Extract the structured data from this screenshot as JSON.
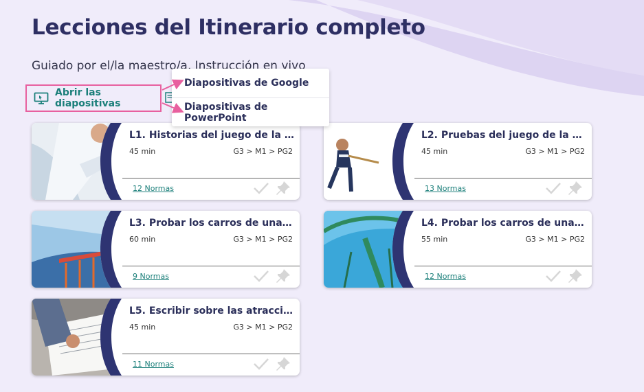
{
  "page": {
    "title": "Lecciones del Itinerario completo",
    "subtitle": "Guiado por el/la maestro/a, Instrucción en vivo"
  },
  "toolbar": {
    "open_slides_label": "Abrir las diapositivas",
    "open_slides_icon": "presentation-icon"
  },
  "slides_menu": {
    "items": [
      {
        "label": "Diapositivas de Google"
      },
      {
        "label": "Diapositivas de PowerPoint"
      }
    ]
  },
  "annotation_color": "#e8609f",
  "lessons": [
    {
      "title": "L1. Historias del juego de la so...",
      "duration": "45 min",
      "path": "G3 > M1 > PG2",
      "standards": "12 Normas"
    },
    {
      "title": "L2. Pruebas del juego de la so...",
      "duration": "45 min",
      "path": "G3 > M1 > PG2",
      "standards": "13 Normas"
    },
    {
      "title": "L3. Probar los carros de una ...",
      "duration": "60 min",
      "path": "G3 > M1 > PG2",
      "standards": "9 Normas"
    },
    {
      "title": "L4. Probar los carros de una ...",
      "duration": "55 min",
      "path": "G3 > M1 > PG2",
      "standards": "12 Normas"
    },
    {
      "title": "L5. Escribir sobre las atraccio...",
      "duration": "45 min",
      "path": "G3 > M1 > PG2",
      "standards": "11 Normas"
    }
  ]
}
